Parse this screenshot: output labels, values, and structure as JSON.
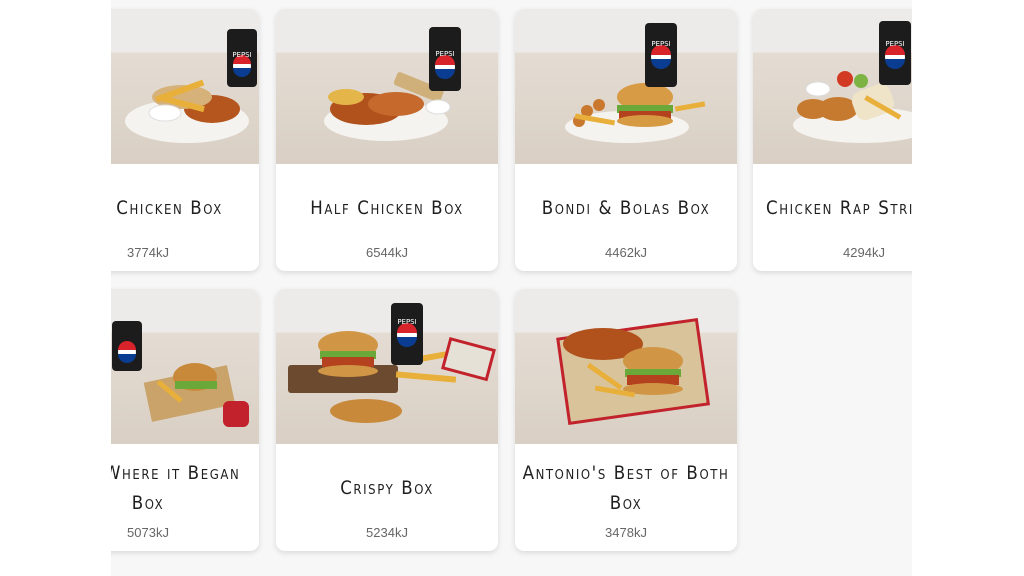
{
  "menu": {
    "items": [
      {
        "name": "Quarter Chicken Box",
        "visible_title": "rter Chicken Box",
        "energy": "3774kJ"
      },
      {
        "name": "Half Chicken Box",
        "visible_title": "Half Chicken Box",
        "energy": "6544kJ"
      },
      {
        "name": "Bondi & Bolas Box",
        "visible_title": "Bondi & Bolas Box",
        "energy": "4462kJ"
      },
      {
        "name": "Chicken Rap Strip Box",
        "visible_title": "Chicken Rap Strip Box",
        "energy": "4294kJ"
      },
      {
        "name": "Antonio's Where it Began Box",
        "visible_title": "nio's Where it Began Box",
        "energy": "5073kJ"
      },
      {
        "name": "Crispy Box",
        "visible_title": "Crispy Box",
        "energy": "5234kJ"
      },
      {
        "name": "Antonio's Best of Both Box",
        "visible_title": "Antonio's Best of Both Box",
        "energy": "3478kJ"
      }
    ]
  },
  "can_label": "PEPSI",
  "colors": {
    "page_background": "#f7f7f7",
    "card_background": "#ffffff",
    "title_text": "#1f1f1f",
    "energy_text": "#666666",
    "pepsi_red": "#d8232a",
    "pepsi_blue": "#0a3d91"
  }
}
